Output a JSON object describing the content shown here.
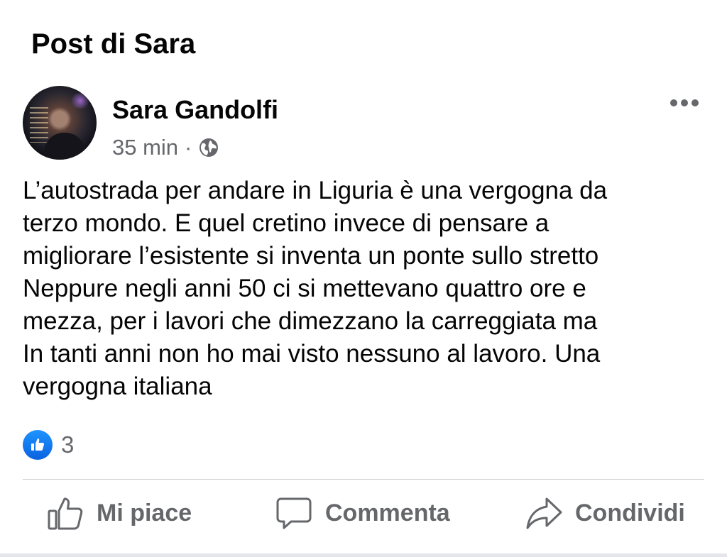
{
  "header": {
    "title": "Post di Sara"
  },
  "post": {
    "author": "Sara Gandolfi",
    "time": "35 min",
    "separator": "·",
    "audience_icon": "globe-icon",
    "text": "L’autostrada per andare in Liguria è una vergogna da\nterzo mondo. E quel cretino invece di pensare a\nmigliorare l’esistente si inventa un ponte sullo stretto\nNeppure negli anni 50 ci si mettevano quattro ore e\nmezza, per i lavori che dimezzano la carreggiata ma\nIn tanti anni non ho mai visto nessuno al lavoro. Una\nvergogna italiana",
    "reactions": {
      "type": "like",
      "count": "3"
    }
  },
  "actions": {
    "like_label": "Mi piace",
    "comment_label": "Commenta",
    "share_label": "Condividi"
  },
  "colors": {
    "text": "#050505",
    "secondary": "#65676b",
    "like_blue": "#1877f2",
    "divider": "#ced0d4"
  }
}
